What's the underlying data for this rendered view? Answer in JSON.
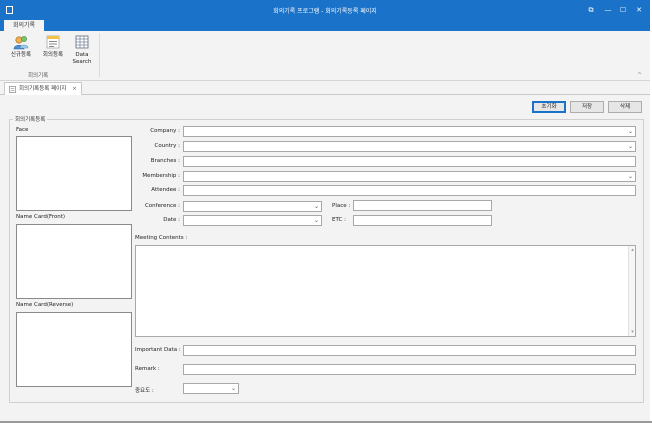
{
  "window": {
    "title": "회의기록 프로그램 - 회의기록등록 페이지",
    "controls": {
      "restore": "⧉",
      "minimize": "—",
      "maximize": "☐",
      "close": "✕"
    }
  },
  "ribbon": {
    "tab_label": "회의기록",
    "buttons": [
      {
        "label": "신규등록",
        "icon": "new-record-icon"
      },
      {
        "label": "회의등록",
        "icon": "meeting-register-icon"
      },
      {
        "label": "Data Search",
        "icon": "data-search-icon"
      }
    ],
    "group_label": "회의기록",
    "collapse": "^"
  },
  "doc_tab": {
    "label": "회의기록등록 페이지",
    "close": "×",
    "icon": "form-icon"
  },
  "toolbar": {
    "reset": "초기화",
    "save": "저장",
    "delete": "삭제"
  },
  "form": {
    "group_title": "회의기록등록",
    "face_label": "Face",
    "card_front_label": "Name Card(Front)",
    "card_reverse_label": "Name Card(Reverse)",
    "company_label": "Company :",
    "country_label": "Country :",
    "branches_label": "Branches :",
    "membership_label": "Membership :",
    "attendee_label": "Attendee :",
    "conference_label": "Conference :",
    "date_label": "Date :",
    "place_label": "Place :",
    "etc_label": "ETC :",
    "meeting_contents_label": "Meeting Contents :",
    "important_data_label": "Important Data :",
    "remark_label": "Remark :",
    "importance_label": "중요도 :",
    "chevron": "⌄"
  },
  "colors": {
    "accent": "#1b73c9",
    "panel": "#f3f3f3"
  }
}
